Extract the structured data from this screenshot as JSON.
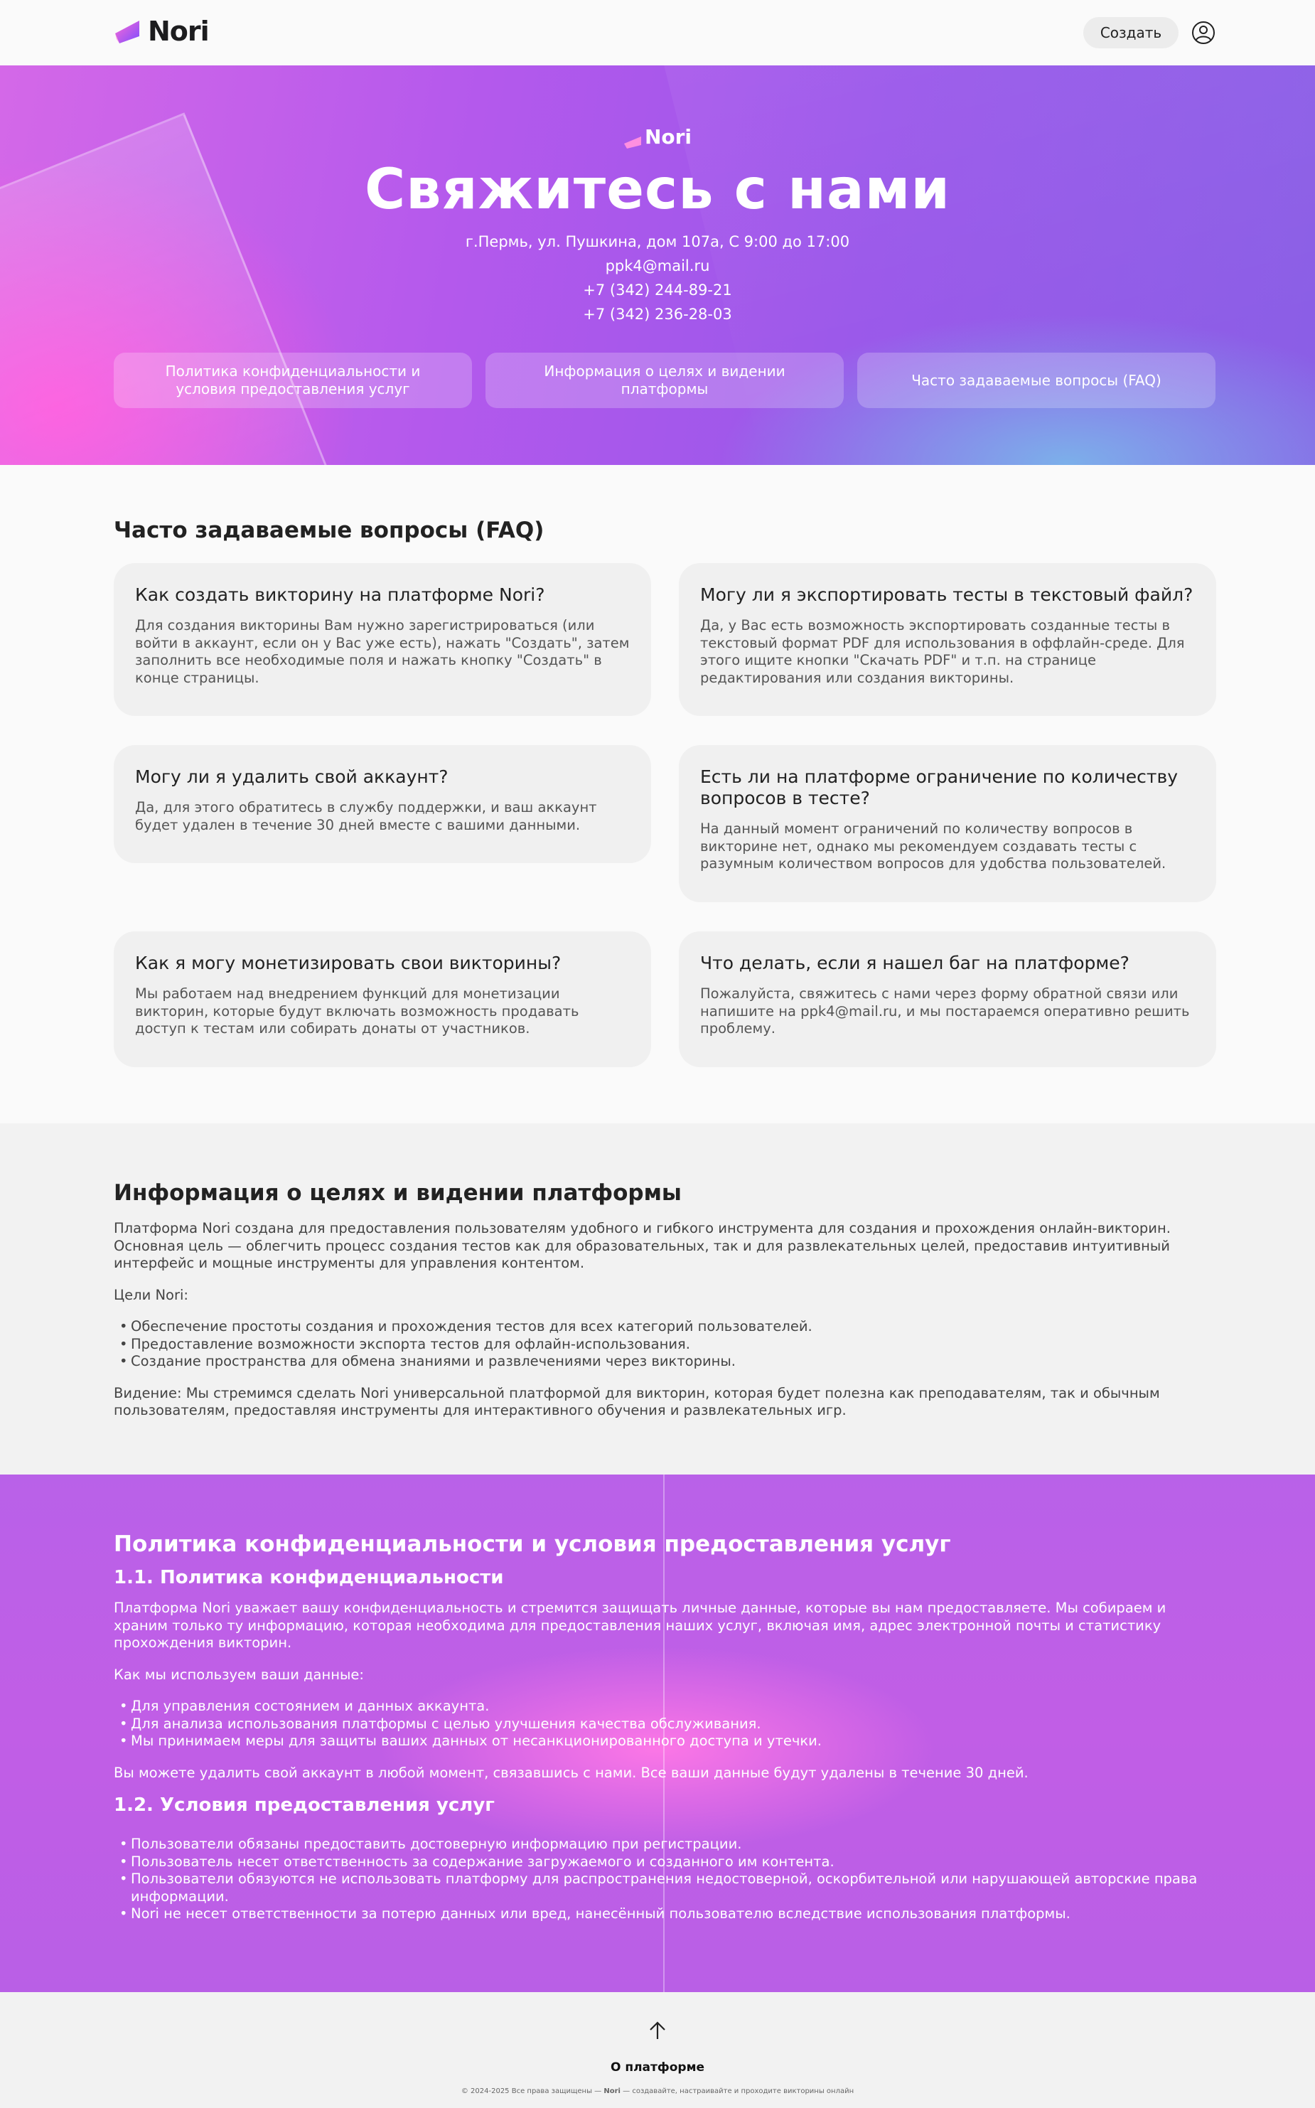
{
  "header": {
    "logo_text": "Nori",
    "create_label": "Создать"
  },
  "hero": {
    "logo_text": "Nori",
    "title": "Свяжитесь с нами",
    "address": "г.Пермь, ул. Пушкина, дом 107а, С 9:00 до 17:00",
    "email": "ppk4@mail.ru",
    "phone1": "+7 (342) 244-89-21",
    "phone2": "+7 (342) 236-28-03",
    "buttons": [
      "Политика конфиденциальности и условия предоставления услуг",
      "Информация о целях и видении платформы",
      "Часто задаваемые вопросы (FAQ)"
    ]
  },
  "faq": {
    "title": "Часто задаваемые вопросы (FAQ)",
    "items": [
      {
        "q": "Как создать викторину на платформе Nori?",
        "a": "Для создания викторины Вам нужно зарегистрироваться (или войти в аккаунт, если он у Вас уже есть), нажать \"Создать\", затем заполнить все необходимые поля и нажать кнопку \"Создать\" в конце страницы."
      },
      {
        "q": "Могу ли я экспортировать тесты в текстовый файл?",
        "a": "Да, у Вас есть возможность экспортировать созданные тесты в текстовый формат PDF для использования в оффлайн-среде. Для этого ищите кнопки \"Скачать PDF\" и т.п. на странице редактирования или создания викторины."
      },
      {
        "q": "Могу ли я удалить свой аккаунт?",
        "a": "Да, для этого обратитесь в службу поддержки, и ваш аккаунт будет удален в течение 30 дней вместе с вашими данными."
      },
      {
        "q": "Есть ли на платформе ограничение по количеству вопросов в тесте?",
        "a": "На данный момент ограничений по количеству вопросов в викторине нет, однако мы рекомендуем создавать тесты с разумным количеством вопросов для удобства пользователей."
      },
      {
        "q": "Как я могу монетизировать свои викторины?",
        "a": "Мы работаем над внедрением функций для монетизации викторин, которые будут включать возможность продавать доступ к тестам или собирать донаты от участников."
      },
      {
        "q": "Что делать, если я нашел баг на платформе?",
        "a": "Пожалуйста, свяжитесь с нами через форму обратной связи или напишите на ppk4@mail.ru, и мы постараемся оперативно решить проблему."
      }
    ]
  },
  "mission": {
    "title": "Информация о целях и видении платформы",
    "intro": "Платформа Nori создана для предоставления пользователям удобного и гибкого инструмента для создания и прохождения онлайн-викторин. Основная цель — облегчить процесс создания тестов как для образовательных, так и для развлекательных целей, предоставив интуитивный интерфейс и мощные инструменты для управления контентом.",
    "goals_label": "Цели Nori:",
    "goals": [
      "Обеспечение простоты создания и прохождения тестов для всех категорий пользователей.",
      "Предоставление возможности экспорта тестов для офлайн-использования.",
      "Создание пространства для обмена знаниями и развлечениями через викторины."
    ],
    "vision": "Видение: Мы стремимся сделать Nori универсальной платформой для викторин, которая будет полезна как преподавателям, так и обычным пользователям, предоставляя инструменты для интерактивного обучения и развлекательных игр."
  },
  "policy": {
    "title": "Политика конфиденциальности и условия предоставления услуг",
    "sub1": "1.1. Политика конфиденциальности",
    "p1": "Платформа Nori уважает вашу конфиденциальность и стремится защищать личные данные, которые вы нам предоставляете. Мы собираем и храним только ту информацию, которая необходима для предоставления наших услуг, включая имя, адрес электронной почты и статистику прохождения викторин.",
    "use_label": "Как мы используем ваши данные:",
    "use_items": [
      "Для управления состоянием и данных аккаунта.",
      "Для анализа использования платформы с целью улучшения качества обслуживания.",
      "Мы принимаем меры для защиты ваших данных от несанкционированного доступа и утечки."
    ],
    "delete_text": "Вы можете удалить свой аккаунт в любой момент, связавшись с нами. Все ваши данные будут удалены в течение 30 дней.",
    "sub2": "1.2. Условия предоставления услуг",
    "terms": [
      "Пользователи обязаны предоставить достоверную информацию при регистрации.",
      "Пользователь несет ответственность за содержание загружаемого и созданного им контента.",
      "Пользователи обязуются не использовать платформу для распространения недостоверной, оскорбительной или нарушающей авторские права информации.",
      "Nori не несет ответственности за потерю данных или вред, нанесённый пользователю вследствие использования платформы."
    ]
  },
  "footer": {
    "about": "О платформе",
    "copy_prefix": "© 2024-2025 Все права защищены — ",
    "copy_brand": "Nori",
    "copy_suffix": " — создавайте, настраивайте и проходите викторины онлайн"
  },
  "colors": {
    "hero_gradient_start": "#d468e8",
    "hero_gradient_end": "#8a5fe6",
    "policy_bg": "#bd5fe7",
    "card_bg": "#f0f0f0"
  },
  "icons": [
    "logo-mark-icon",
    "user-icon",
    "arrow-up-icon"
  ]
}
